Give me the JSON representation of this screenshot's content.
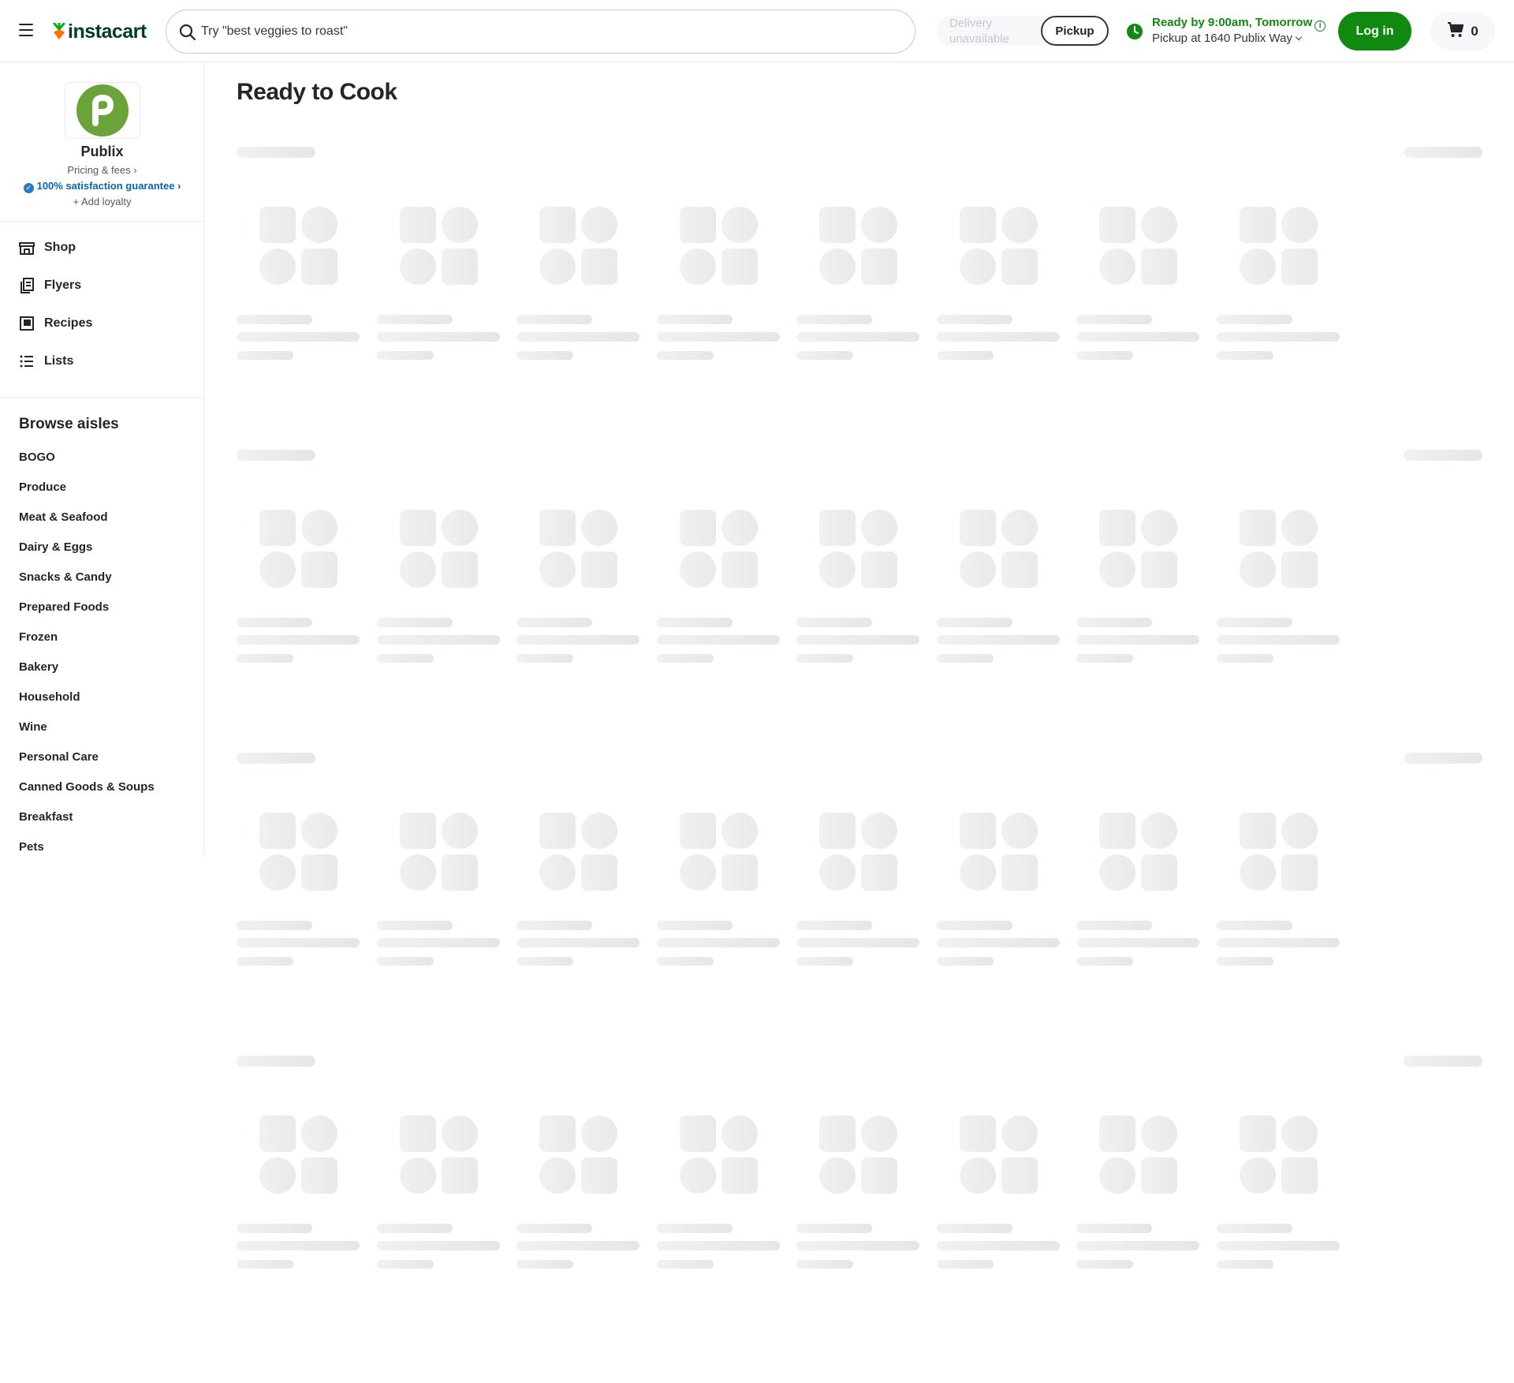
{
  "header": {
    "brand": "instacart",
    "search_placeholder": "Try \"best veggies to roast\"",
    "delivery_label_line1": "Delivery",
    "delivery_label_line2": "unavailable",
    "pickup_label": "Pickup",
    "ready_label": "Ready by 9:00am, Tomorrow",
    "pickup_location": "Pickup at 1640 Publix Way",
    "login_label": "Log in",
    "cart_count": "0"
  },
  "store": {
    "name": "Publix",
    "pricing_label": "Pricing & fees ›",
    "guarantee_label": "100% satisfaction guarantee ›",
    "loyalty_label": "+ Add loyalty",
    "brand_color": "#6AA33A"
  },
  "nav": [
    {
      "label": "Shop",
      "icon": "store-icon"
    },
    {
      "label": "Flyers",
      "icon": "flyer-icon"
    },
    {
      "label": "Recipes",
      "icon": "recipe-book-icon"
    },
    {
      "label": "Lists",
      "icon": "list-icon"
    }
  ],
  "browse": {
    "title": "Browse aisles",
    "aisles": [
      "BOGO",
      "Produce",
      "Meat & Seafood",
      "Dairy & Eggs",
      "Snacks & Candy",
      "Prepared Foods",
      "Frozen",
      "Bakery",
      "Household",
      "Wine",
      "Personal Care",
      "Canned Goods & Soups",
      "Breakfast",
      "Pets"
    ]
  },
  "main": {
    "title": "Ready to Cook",
    "loading": true,
    "skeleton_rows": 4,
    "skeleton_cards_per_row": 8
  },
  "colors": {
    "accent_green": "#108910",
    "brand_dark_green": "#003D29",
    "carrot_orange": "#FF7009",
    "link_blue": "#0A66A8"
  }
}
